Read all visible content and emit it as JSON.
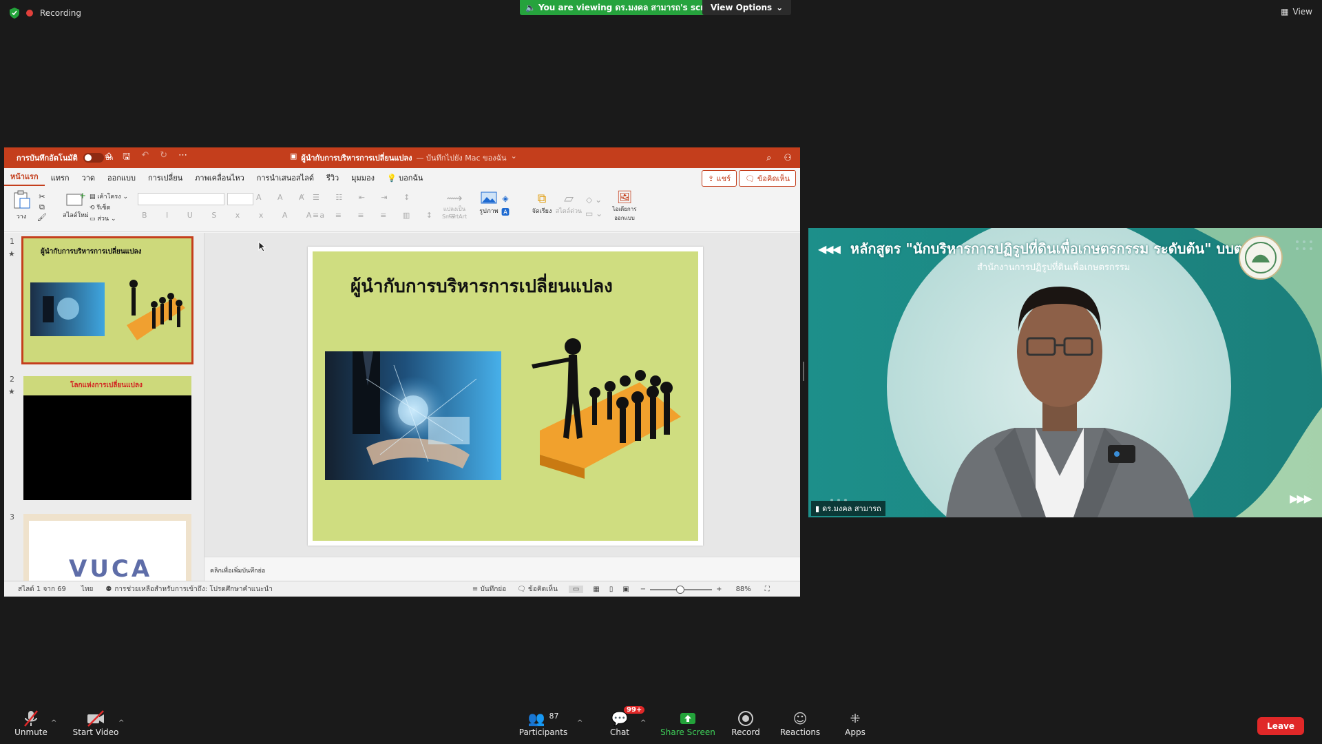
{
  "zoom_top": {
    "recording_label": "Recording",
    "viewing_banner": "You are viewing ดร.มงคล สามารถ's screen",
    "view_options_label": "View Options",
    "view_label": "View"
  },
  "powerpoint": {
    "autosave_label": "การบันทึกอัตโนมัติ",
    "autosave_state": "ปิด",
    "doc_title": "ผู้นำกับการบริหารการเปลี่ยนแปลง",
    "doc_subtitle": "— บันทึกไปยัง Mac ของฉัน",
    "menu_tabs": [
      "หน้าแรก",
      "แทรก",
      "วาด",
      "ออกแบบ",
      "การเปลี่ยน",
      "ภาพเคลื่อนไหว",
      "การนำเสนอสไลด์",
      "รีวิว",
      "มุมมอง",
      "บอกฉัน"
    ],
    "share_label": "แชร์",
    "comments_label": "ข้อคิดเห็น",
    "ribbon": {
      "paste": "วาง",
      "new_slide": "สไลด์ใหม่",
      "layout": "เค้าโครง",
      "reset": "รีเซ็ต",
      "section": "ส่วน",
      "convert_smartart": "แปลงเป็น SmartArt",
      "picture": "รูปภาพ",
      "arrange": "จัดเรียง",
      "quick_styles": "สไตล์ด่วน",
      "design_ideas": "ไอเดียการออกแบบ"
    },
    "slides": [
      {
        "number": "1",
        "title": "ผู้นำกับการบริหารการเปลี่ยนแปลง"
      },
      {
        "number": "2",
        "title": "โลกแห่งการเปลี่ยนแปลง"
      },
      {
        "number": "3",
        "title": "VUCA"
      }
    ],
    "current_slide_title": "ผู้นำกับการบริหารการเปลี่ยนแปลง",
    "notes_placeholder": "คลิกเพื่อเพิ่มบันทึกย่อ",
    "status": {
      "slide_counter": "สไลด์ 1 จาก 69",
      "language": "ไทย",
      "accessibility": "การช่วยเหลือสำหรับการเข้าถึง: โปรดศึกษาคำแนะนำ",
      "notes_btn": "บันทึกย่อ",
      "comments_btn": "ข้อคิดเห็น",
      "zoom": "88%"
    }
  },
  "video": {
    "banner_title": "หลักสูตร \"นักบริหารการปฏิรูปที่ดินเพื่อเกษตรกรรม ระดับต้น\" บบต.",
    "banner_sub": "สำนักงานการปฏิรูปที่ดินเพื่อเกษตรกรรม",
    "participant_name": "ดร.มงคล สามารถ"
  },
  "toolbar": {
    "unmute": "Unmute",
    "start_video": "Start Video",
    "participants": "Participants",
    "participants_count": "87",
    "chat": "Chat",
    "chat_badge": "99+",
    "share_screen": "Share Screen",
    "record": "Record",
    "reactions": "Reactions",
    "apps": "Apps",
    "leave": "Leave"
  }
}
